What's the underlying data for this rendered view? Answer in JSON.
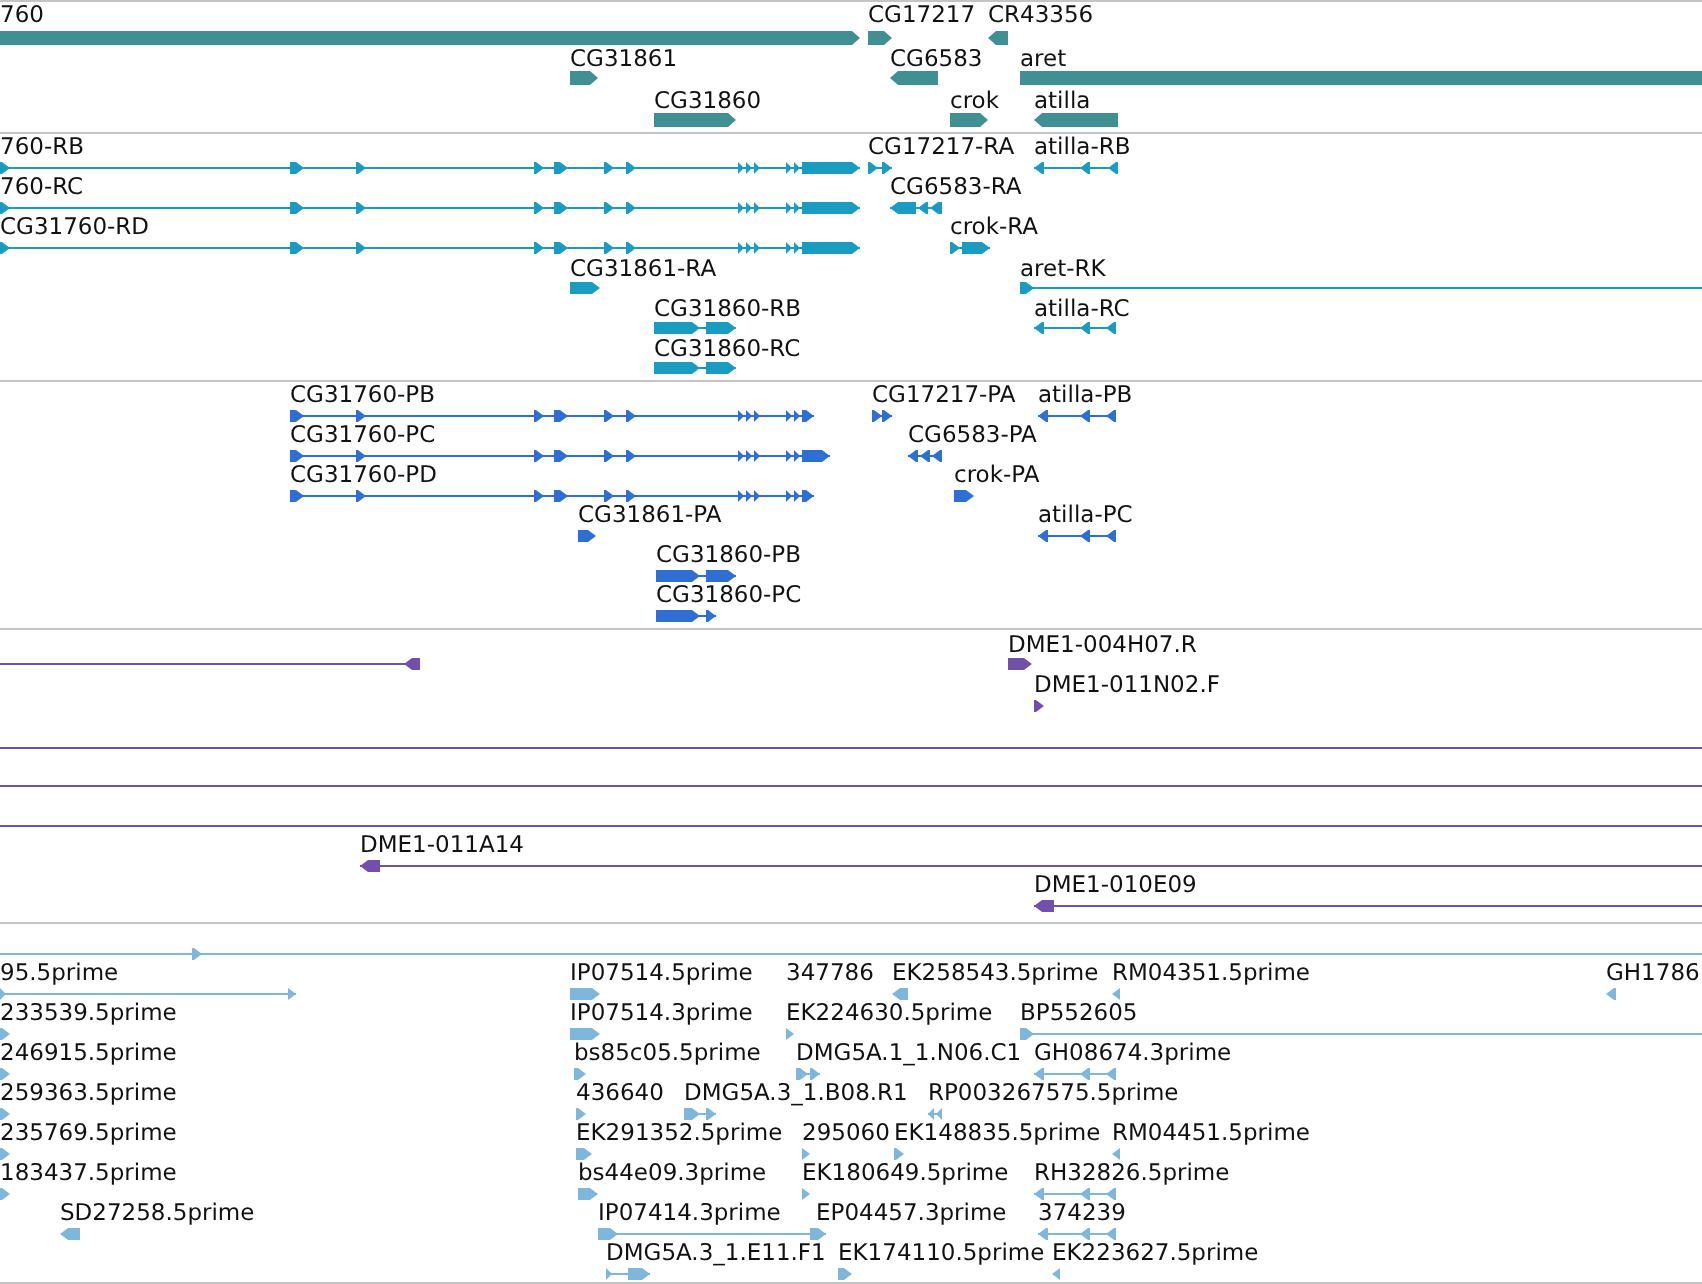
{
  "tracks": [
    {
      "color": "#3f8f93",
      "features": [
        {
          "label": "760",
          "reverse": false
        },
        {
          "label": "CG17217",
          "reverse": false
        },
        {
          "label": "CR43356",
          "reverse": true
        },
        {
          "label": "CG31861",
          "reverse": false
        },
        {
          "label": "CG6583",
          "reverse": true
        },
        {
          "label": "aret",
          "reverse": false
        },
        {
          "label": "CG31860",
          "reverse": false
        },
        {
          "label": "crok",
          "reverse": false
        },
        {
          "label": "atilla",
          "reverse": true
        }
      ]
    },
    {
      "color": "#1a9cc0",
      "features": [
        {
          "label": "760-RB",
          "reverse": false
        },
        {
          "label": "CG17217-RA",
          "reverse": false
        },
        {
          "label": "atilla-RB",
          "reverse": true
        },
        {
          "label": "760-RC",
          "reverse": false
        },
        {
          "label": "CG6583-RA",
          "reverse": true
        },
        {
          "label": "CG31760-RD",
          "reverse": false
        },
        {
          "label": "crok-RA",
          "reverse": false
        },
        {
          "label": "CG31861-RA",
          "reverse": false
        },
        {
          "label": "aret-RK",
          "reverse": false
        },
        {
          "label": "CG31860-RB",
          "reverse": false
        },
        {
          "label": "atilla-RC",
          "reverse": true
        },
        {
          "label": "CG31860-RC",
          "reverse": false
        }
      ]
    },
    {
      "color": "#2f6fd4",
      "features": [
        {
          "label": "CG31760-PB",
          "reverse": false
        },
        {
          "label": "CG17217-PA",
          "reverse": false
        },
        {
          "label": "atilla-PB",
          "reverse": true
        },
        {
          "label": "CG31760-PC",
          "reverse": false
        },
        {
          "label": "CG6583-PA",
          "reverse": true
        },
        {
          "label": "CG31760-PD",
          "reverse": false
        },
        {
          "label": "crok-PA",
          "reverse": false
        },
        {
          "label": "CG31861-PA",
          "reverse": false
        },
        {
          "label": "atilla-PC",
          "reverse": true
        },
        {
          "label": "CG31860-PB",
          "reverse": false
        },
        {
          "label": "CG31860-PC",
          "reverse": false
        }
      ]
    },
    {
      "color": "#7050a8",
      "features": [
        {
          "kind": "model",
          "reverse": true
        },
        {
          "kind": "model",
          "label": "DME1-004H07.R",
          "reverse": false
        },
        {
          "kind": "model",
          "label": "DME1-011N02.F",
          "reverse": false
        },
        {
          "kind": "span"
        },
        {
          "kind": "span"
        },
        {
          "kind": "span"
        },
        {
          "kind": "model",
          "label": "DME1-011A14",
          "reverse": true
        },
        {
          "kind": "model",
          "label": "DME1-010E09",
          "reverse": true
        }
      ]
    },
    {
      "color": "#7fb6dc",
      "features": [
        {
          "reverse": false
        },
        {
          "label": "95.5prime",
          "reverse": false
        },
        {
          "label": "IP07514.5prime",
          "reverse": false
        },
        {
          "label": "347786"
        },
        {
          "label": "EK258543.5prime",
          "reverse": true
        },
        {
          "label": "RM04351.5prime",
          "reverse": true
        },
        {
          "label": "GH1786",
          "reverse": true
        },
        {
          "label": "233539.5prime",
          "reverse": false
        },
        {
          "label": "IP07514.3prime",
          "reverse": false
        },
        {
          "label": "EK224630.5prime",
          "reverse": false
        },
        {
          "label": "BP552605",
          "reverse": false
        },
        {
          "label": "246915.5prime",
          "reverse": false
        },
        {
          "label": "bs85c05.5prime",
          "reverse": false
        },
        {
          "label": "DMG5A.1_1.N06.C1",
          "reverse": false
        },
        {
          "label": "GH08674.3prime",
          "reverse": true
        },
        {
          "label": "259363.5prime",
          "reverse": false
        },
        {
          "label": "436640",
          "reverse": false
        },
        {
          "label": "DMG5A.3_1.B08.R1",
          "reverse": false
        },
        {
          "label": "RP003267575.5prime",
          "reverse": true
        },
        {
          "label": "235769.5prime",
          "reverse": false
        },
        {
          "label": "EK291352.5prime",
          "reverse": false
        },
        {
          "label": "295060",
          "reverse": false
        },
        {
          "label": "EK148835.5prime",
          "reverse": false
        },
        {
          "label": "RM04451.5prime",
          "reverse": true
        },
        {
          "label": "183437.5prime",
          "reverse": false
        },
        {
          "label": "bs44e09.3prime",
          "reverse": false
        },
        {
          "label": "EK180649.5prime",
          "reverse": false
        },
        {
          "label": "RH32826.5prime",
          "reverse": true
        },
        {
          "label": "SD27258.5prime",
          "reverse": true
        },
        {
          "label": "IP07414.3prime",
          "reverse": false
        },
        {
          "label": "EP04457.3prime"
        },
        {
          "label": "374239",
          "reverse": true
        },
        {
          "label": "DMG5A.3_1.E11.F1",
          "reverse": false
        },
        {
          "label": "EK174110.5prime",
          "reverse": false
        },
        {
          "label": "EK223627.5prime",
          "reverse": true
        }
      ]
    }
  ]
}
